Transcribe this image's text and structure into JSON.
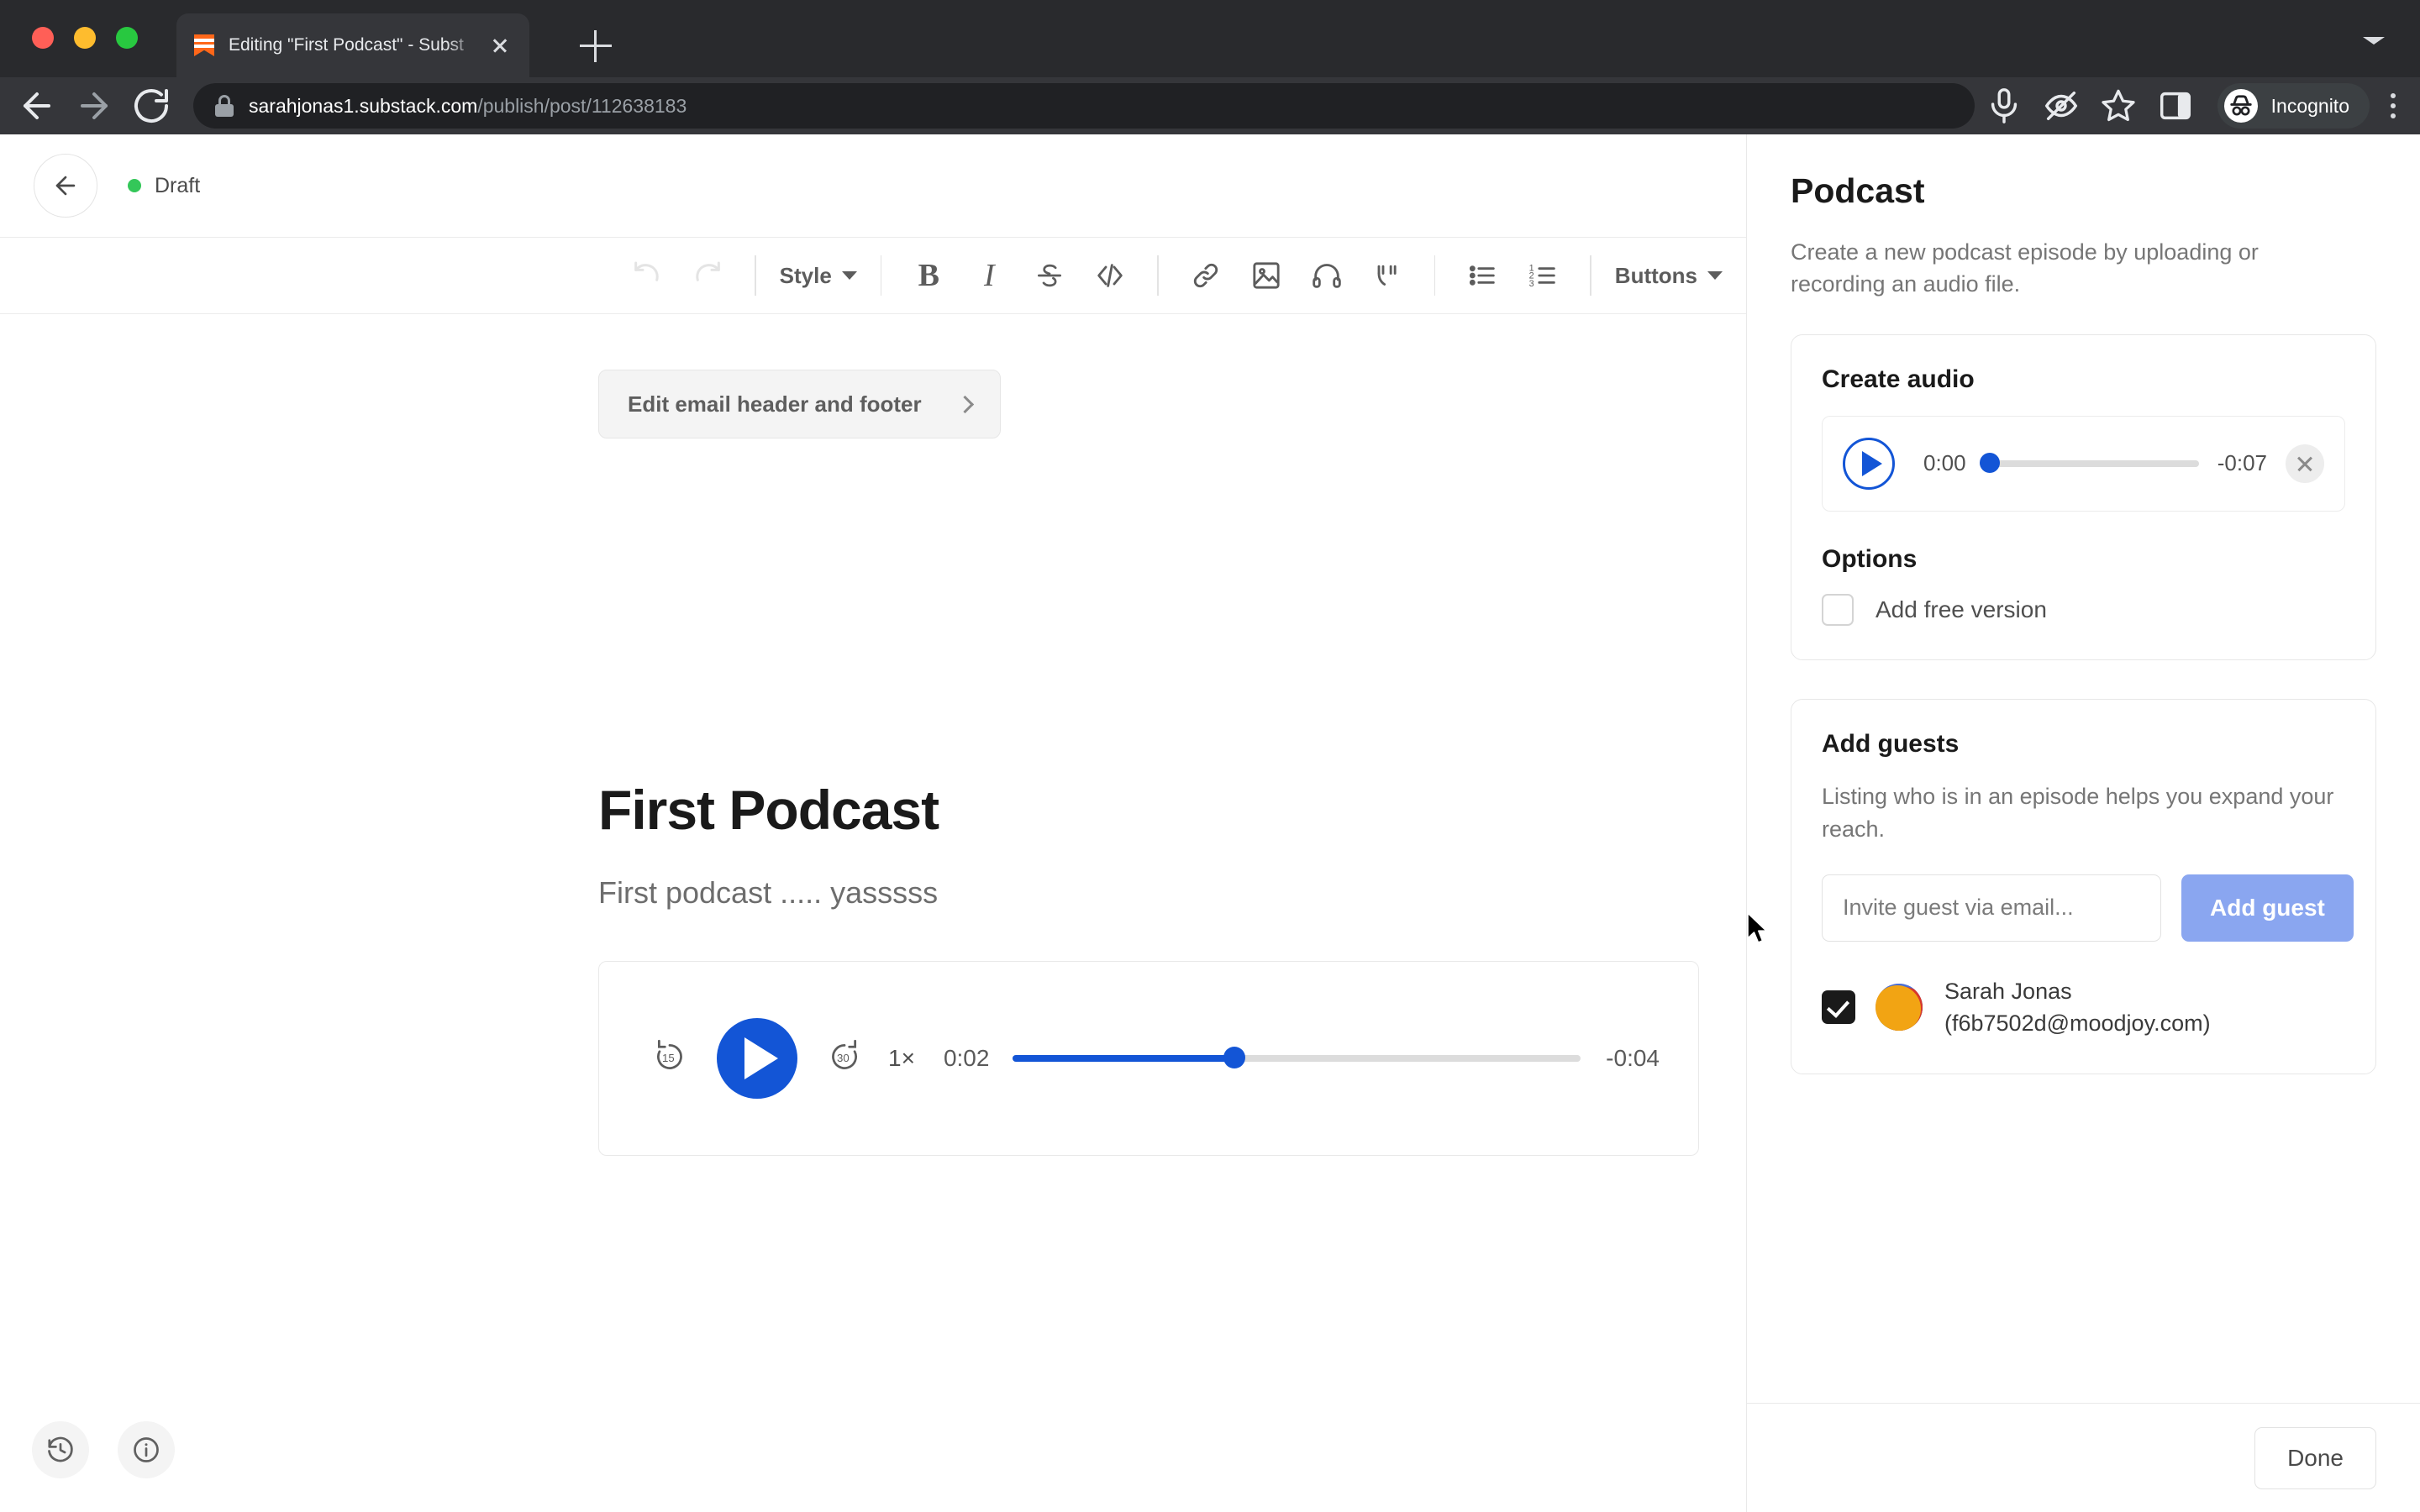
{
  "browser": {
    "tab": {
      "title": "Editing \"First Podcast\" - Subst",
      "favicon": "substack-icon",
      "close_icon": "close-icon"
    },
    "new_tab_icon": "plus-icon",
    "tab_list_icon": "chevron-down-icon",
    "nav": {
      "back_icon": "arrow-left-icon",
      "forward_icon": "arrow-right-icon",
      "reload_icon": "reload-icon"
    },
    "omnibox": {
      "lock_icon": "lock-icon",
      "url_host": "sarahjonas1.substack.com",
      "url_path": "/publish/post/112638183"
    },
    "actions": {
      "mic_icon": "microphone-icon",
      "tracking_icon": "eye-off-icon",
      "bookmark_icon": "star-icon",
      "sidepanel_icon": "side-panel-icon",
      "incognito_icon": "incognito-icon",
      "incognito_label": "Incognito",
      "menu_icon": "kebab-menu-icon"
    }
  },
  "editor": {
    "back_icon": "arrow-left-icon",
    "status_label": "Draft",
    "status_color": "#34c759",
    "toolbar": {
      "undo_icon": "undo-icon",
      "redo_icon": "redo-icon",
      "style_label": "Style",
      "bold_label": "B",
      "italic_label": "I",
      "strikethrough_label": "S",
      "code_label": "</>",
      "link_icon": "link-icon",
      "image_icon": "image-icon",
      "audio_icon": "headphones-icon",
      "quote_icon": "quote-icon",
      "bullet_list_icon": "bullet-list-icon",
      "numbered_list_icon": "numbered-list-icon",
      "buttons_label": "Buttons"
    },
    "header_footer_button": "Edit email header and footer",
    "title": "First Podcast",
    "subtitle": "First podcast ..... yasssss",
    "audio_embed": {
      "rewind_label": "15",
      "forward_label": "30",
      "play_icon": "play-icon",
      "speed": "1×",
      "elapsed": "0:02",
      "remaining": "-0:04",
      "progress_percent": 39,
      "accent_color": "#1355d6"
    },
    "floating": {
      "history_icon": "history-icon",
      "info_icon": "info-icon"
    }
  },
  "sidebar": {
    "title": "Podcast",
    "description": "Create a new podcast episode by uploading or recording an audio file.",
    "create_audio": {
      "heading": "Create audio",
      "player": {
        "play_icon": "play-icon",
        "elapsed": "0:00",
        "remaining": "-0:07",
        "progress_percent": 0,
        "remove_icon": "close-icon"
      },
      "options_heading": "Options",
      "options": [
        {
          "label": "Add free version",
          "checked": false
        }
      ]
    },
    "add_guests": {
      "heading": "Add guests",
      "description": "Listing who is in an episode helps you expand your reach.",
      "email_placeholder": "Invite guest via email...",
      "email_value": "",
      "add_button_label": "Add guest",
      "add_button_color": "#8aa6f0",
      "guests": [
        {
          "name": "Sarah Jonas",
          "email": "(f6b7502d@moodjoy.com)",
          "checked": true,
          "avatar": "user-avatar"
        }
      ]
    },
    "footer": {
      "done_label": "Done"
    }
  }
}
